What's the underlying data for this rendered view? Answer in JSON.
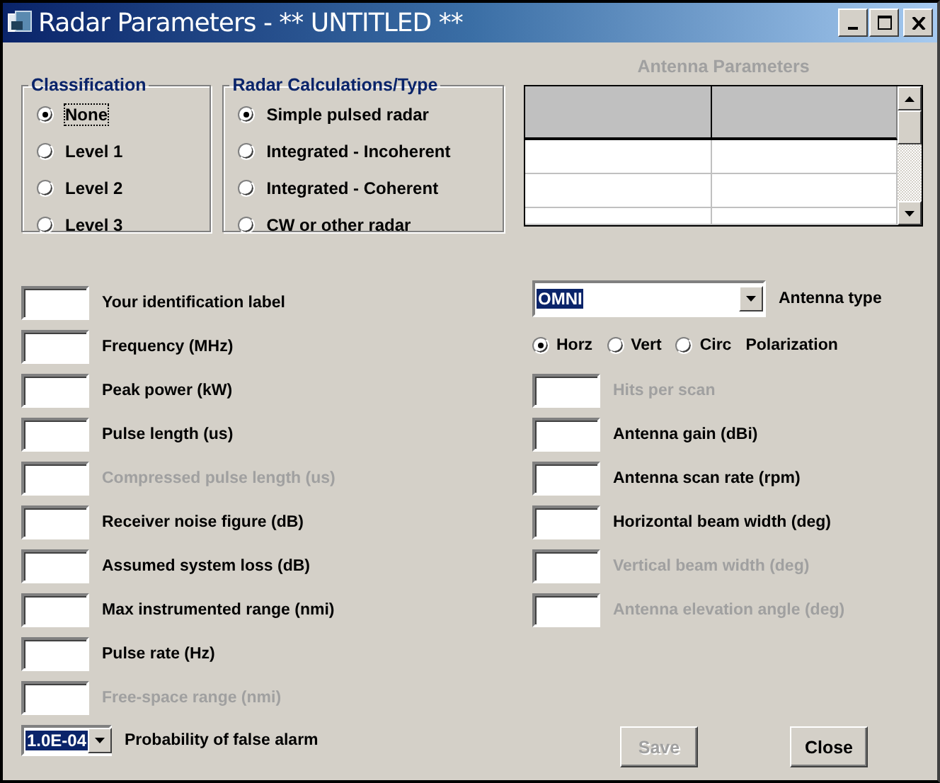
{
  "window": {
    "title": "Radar Parameters - ** UNTITLED **"
  },
  "classification": {
    "title": "Classification",
    "options": [
      {
        "label": "None",
        "selected": true,
        "focused": true
      },
      {
        "label": "Level 1",
        "selected": false,
        "focused": false
      },
      {
        "label": "Level 2",
        "selected": false,
        "focused": false
      },
      {
        "label": "Level 3",
        "selected": false,
        "focused": false
      }
    ]
  },
  "radar_type": {
    "title": "Radar Calculations/Type",
    "options": [
      {
        "label": "Simple pulsed radar",
        "selected": true
      },
      {
        "label": "Integrated - Incoherent",
        "selected": false
      },
      {
        "label": "Integrated - Coherent",
        "selected": false
      },
      {
        "label": "CW or other radar",
        "selected": false
      }
    ]
  },
  "antenna_parameters": {
    "title": "Antenna Parameters",
    "disabled": true
  },
  "left_fields": [
    {
      "label": "Your identification label",
      "disabled": false
    },
    {
      "label": "Frequency (MHz)",
      "disabled": false
    },
    {
      "label": "Peak power (kW)",
      "disabled": false
    },
    {
      "label": "Pulse length (us)",
      "disabled": false
    },
    {
      "label": "Compressed pulse length (us)",
      "disabled": true
    },
    {
      "label": "Receiver noise figure (dB)",
      "disabled": false
    },
    {
      "label": "Assumed system loss (dB)",
      "disabled": false
    },
    {
      "label": "Max instrumented range (nmi)",
      "disabled": false
    },
    {
      "label": "Pulse rate (Hz)",
      "disabled": false
    },
    {
      "label": "Free-space range (nmi)",
      "disabled": true
    }
  ],
  "false_alarm": {
    "value": "1.0E-04",
    "label": "Probability of false alarm"
  },
  "antenna_type": {
    "value": "OMNI",
    "label": "Antenna type"
  },
  "polarization": {
    "label": "Polarization",
    "options": [
      {
        "label": "Horz",
        "selected": true
      },
      {
        "label": "Vert",
        "selected": false
      },
      {
        "label": "Circ",
        "selected": false
      }
    ]
  },
  "right_fields": [
    {
      "label": "Hits per scan",
      "disabled": true
    },
    {
      "label": "Antenna gain (dBi)",
      "disabled": false
    },
    {
      "label": "Antenna scan rate (rpm)",
      "disabled": false
    },
    {
      "label": "Horizontal beam width (deg)",
      "disabled": false
    },
    {
      "label": "Vertical beam width (deg)",
      "disabled": true
    },
    {
      "label": "Antenna elevation angle (deg)",
      "disabled": true
    }
  ],
  "buttons": [
    {
      "label": "Save",
      "disabled": true
    },
    {
      "label": "Close",
      "disabled": false
    }
  ]
}
